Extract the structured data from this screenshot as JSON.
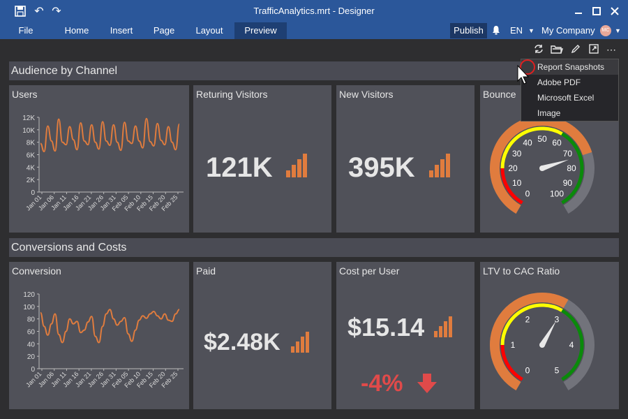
{
  "window": {
    "title": "TrafficAnalytics.mrt - Designer"
  },
  "ribbon": {
    "tabs": [
      {
        "label": "File"
      },
      {
        "label": "Home"
      },
      {
        "label": "Insert"
      },
      {
        "label": "Page"
      },
      {
        "label": "Layout"
      },
      {
        "label": "Preview"
      }
    ],
    "active_tab": "Preview",
    "publish_label": "Publish",
    "language": "EN",
    "company": "My Company",
    "avatar_initials": "MC"
  },
  "sections": {
    "audience": "Audience by Channel",
    "conversions": "Conversions and Costs"
  },
  "panels": {
    "users": {
      "title": "Users"
    },
    "returning": {
      "title": "Returing Visitors",
      "value": "121K"
    },
    "new_visitors": {
      "title": "New Visitors",
      "value": "395K"
    },
    "bounce": {
      "title": "Bounce"
    },
    "conversion": {
      "title": "Conversion"
    },
    "paid": {
      "title": "Paid",
      "value": "$2.48K"
    },
    "cost_per_user": {
      "title": "Cost per User",
      "value": "$15.14",
      "change": "-4%"
    },
    "ltv": {
      "title": "LTV to CAC Ratio"
    }
  },
  "dropdown": {
    "items": [
      {
        "label": "Report Snapshots"
      },
      {
        "label": "Adobe PDF"
      },
      {
        "label": "Microsoft Excel"
      },
      {
        "label": "Image"
      }
    ]
  },
  "colors": {
    "accent": "#e07c3e",
    "title_bar": "#2b579a",
    "panel": "#505159",
    "negative": "#e04a4a"
  },
  "chart_data": [
    {
      "type": "line",
      "title": "Users",
      "x": [
        "Jan 01",
        "Jan 06",
        "Jan 11",
        "Jan 16",
        "Jan 21",
        "Jan 26",
        "Jan 31",
        "Feb 05",
        "Feb 10",
        "Feb 15",
        "Feb 20",
        "Feb 25"
      ],
      "y_ticks": [
        "12K",
        "10K",
        "8K",
        "6K",
        "4K",
        "2K",
        "0"
      ],
      "ylim": [
        0,
        12000
      ],
      "series": [
        {
          "values": [
            7800,
            6500,
            10600,
            8200,
            6600,
            11700,
            8000,
            7600,
            10500,
            8400,
            6800,
            11100,
            8200,
            7600,
            10800,
            8000,
            6900,
            11300,
            8200,
            7500,
            10800,
            8000,
            6700,
            11200,
            8200,
            7800,
            10600,
            8200,
            7100,
            11800,
            8100,
            7400,
            11000,
            8300,
            7600,
            10500,
            8000,
            6800,
            10900
          ]
        }
      ]
    },
    {
      "type": "line",
      "title": "Conversion",
      "x": [
        "Jan 01",
        "Jan 06",
        "Jan 11",
        "Jan 16",
        "Jan 21",
        "Jan 26",
        "Jan 31",
        "Feb 05",
        "Feb 10",
        "Feb 15",
        "Feb 20",
        "Feb 25"
      ],
      "y_ticks": [
        "120",
        "100",
        "80",
        "60",
        "40",
        "20",
        "0"
      ],
      "ylim": [
        0,
        120
      ],
      "series": [
        {
          "values": [
            90,
            68,
            54,
            72,
            88,
            55,
            42,
            60,
            80,
            72,
            76,
            58,
            62,
            75,
            84,
            52,
            42,
            68,
            88,
            95,
            80,
            70,
            76,
            82,
            56,
            44,
            62,
            78,
            85,
            81,
            88,
            92,
            85,
            80,
            88,
            78,
            76,
            88,
            95
          ]
        }
      ]
    },
    {
      "type": "gauge",
      "title": "Bounce",
      "min": 0,
      "max": 100,
      "ticks": [
        0,
        10,
        20,
        30,
        40,
        50,
        60,
        70,
        80,
        90,
        100
      ],
      "value": 74
    },
    {
      "type": "gauge",
      "title": "LTV to CAC Ratio",
      "min": 0,
      "max": 5,
      "ticks": [
        0,
        1,
        2,
        3,
        4,
        5
      ],
      "value": 3
    }
  ]
}
